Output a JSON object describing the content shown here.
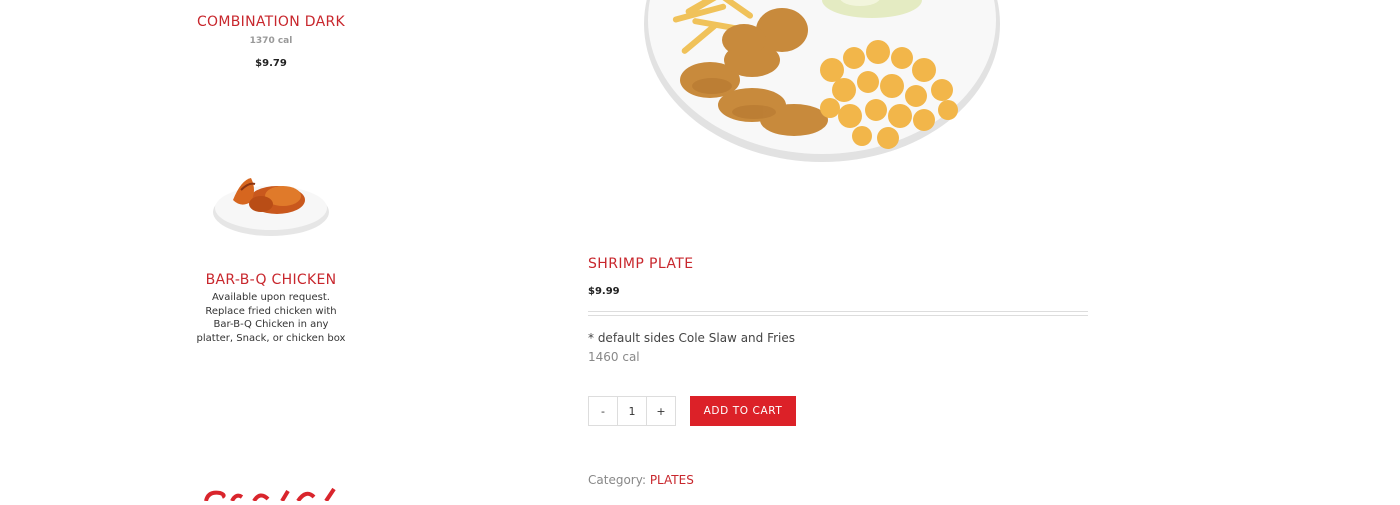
{
  "sidebar": {
    "items": [
      {
        "title": "COMBINATION DARK",
        "calories": "1370 cal",
        "price": "$9.79"
      },
      {
        "title": "BAR-B-Q CHICKEN",
        "description": "Available upon request. Replace fried chicken with Bar-B-Q Chicken in any platter, Snack, or chicken box"
      }
    ]
  },
  "product": {
    "title": "SHRIMP PLATE",
    "price": "$9.99",
    "description": "* default sides Cole Slaw and Fries",
    "calories": "1460 cal",
    "quantity": {
      "minus": "-",
      "value": "1",
      "plus": "+"
    },
    "add_to_cart": "ADD TO CART",
    "category_label": "Category:",
    "category_value": "PLATES"
  },
  "colors": {
    "accent": "#c8272d",
    "button": "#dc2128"
  }
}
